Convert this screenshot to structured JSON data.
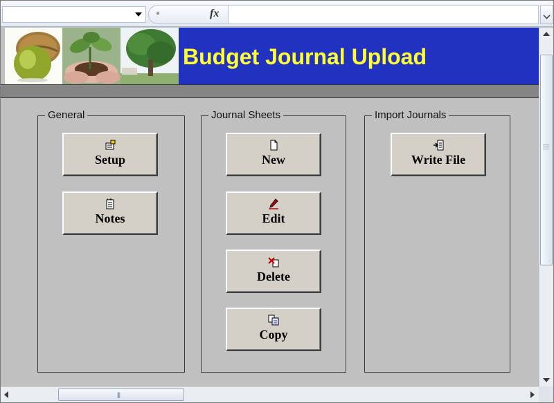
{
  "banner": {
    "title": "Budget Journal Upload"
  },
  "formula_bar": {
    "name_box_value": "",
    "formula_value": "",
    "fx_label": "fx"
  },
  "groups": {
    "general": {
      "label": "General",
      "buttons": [
        {
          "label": "Setup",
          "icon": "setup-icon"
        },
        {
          "label": "Notes",
          "icon": "notes-icon"
        }
      ]
    },
    "journal_sheets": {
      "label": "Journal Sheets",
      "buttons": [
        {
          "label": "New",
          "icon": "new-page-icon"
        },
        {
          "label": "Edit",
          "icon": "edit-pencil-icon"
        },
        {
          "label": "Delete",
          "icon": "delete-icon"
        },
        {
          "label": "Copy",
          "icon": "copy-icon"
        }
      ]
    },
    "import_journals": {
      "label": "Import Journals",
      "buttons": [
        {
          "label": "Write File",
          "icon": "write-file-icon"
        }
      ]
    }
  },
  "colors": {
    "banner_bg": "#2132c0",
    "banner_title": "#ffff33",
    "sheet_bg": "#c0c0c0",
    "button_face": "#d4d0c8"
  }
}
